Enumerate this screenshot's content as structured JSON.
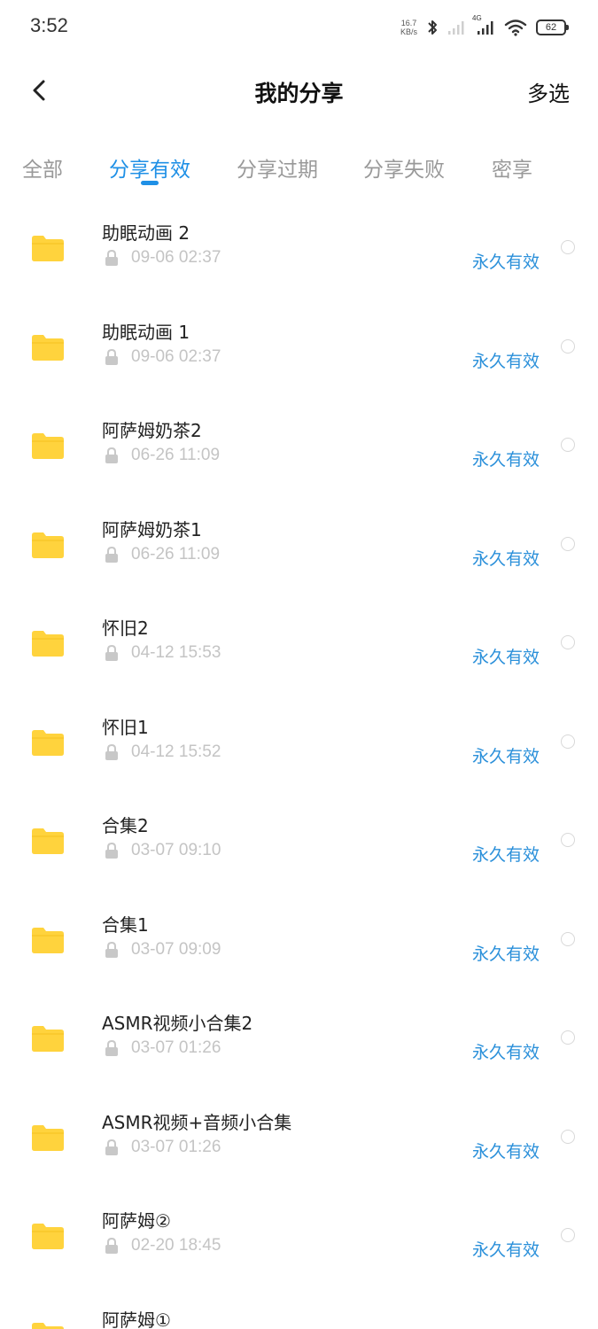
{
  "status_bar": {
    "time": "3:52",
    "net_speed_value": "16.7",
    "net_speed_unit": "KB/s",
    "network_type": "4G",
    "battery": "62"
  },
  "header": {
    "title": "我的分享",
    "multi_select": "多选"
  },
  "tabs": [
    {
      "label": "全部",
      "active": false
    },
    {
      "label": "分享有效",
      "active": true
    },
    {
      "label": "分享过期",
      "active": false
    },
    {
      "label": "分享失败",
      "active": false
    },
    {
      "label": "密享",
      "active": false
    }
  ],
  "shares": [
    {
      "name": "助眠动画 2",
      "date": "09-06 02:37",
      "validity": "永久有效"
    },
    {
      "name": "助眠动画 1",
      "date": "09-06 02:37",
      "validity": "永久有效"
    },
    {
      "name": "阿萨姆奶茶2",
      "date": "06-26 11:09",
      "validity": "永久有效"
    },
    {
      "name": "阿萨姆奶茶1",
      "date": "06-26 11:09",
      "validity": "永久有效"
    },
    {
      "name": "怀旧2",
      "date": "04-12 15:53",
      "validity": "永久有效"
    },
    {
      "name": "怀旧1",
      "date": "04-12 15:52",
      "validity": "永久有效"
    },
    {
      "name": "合集2",
      "date": "03-07 09:10",
      "validity": "永久有效"
    },
    {
      "name": "合集1",
      "date": "03-07 09:09",
      "validity": "永久有效"
    },
    {
      "name": "ASMR视频小合集2",
      "date": "03-07 01:26",
      "validity": "永久有效"
    },
    {
      "name": "ASMR视频+音频小合集",
      "date": "03-07 01:26",
      "validity": "永久有效"
    },
    {
      "name": "阿萨姆②",
      "date": "02-20 18:45",
      "validity": "永久有效"
    },
    {
      "name": "阿萨姆①",
      "date": "",
      "validity": ""
    }
  ],
  "colors": {
    "accent": "#1f90e6",
    "folder": "#ffd33d",
    "validity_text": "#2b90da",
    "muted_text": "#c4c4c4"
  },
  "icons": {
    "back": "chevron-left-icon",
    "folder": "folder-icon",
    "lock": "lock-icon",
    "bluetooth": "bluetooth-icon",
    "wifi": "wifi-icon",
    "signal": "signal-icon",
    "battery": "battery-icon"
  }
}
